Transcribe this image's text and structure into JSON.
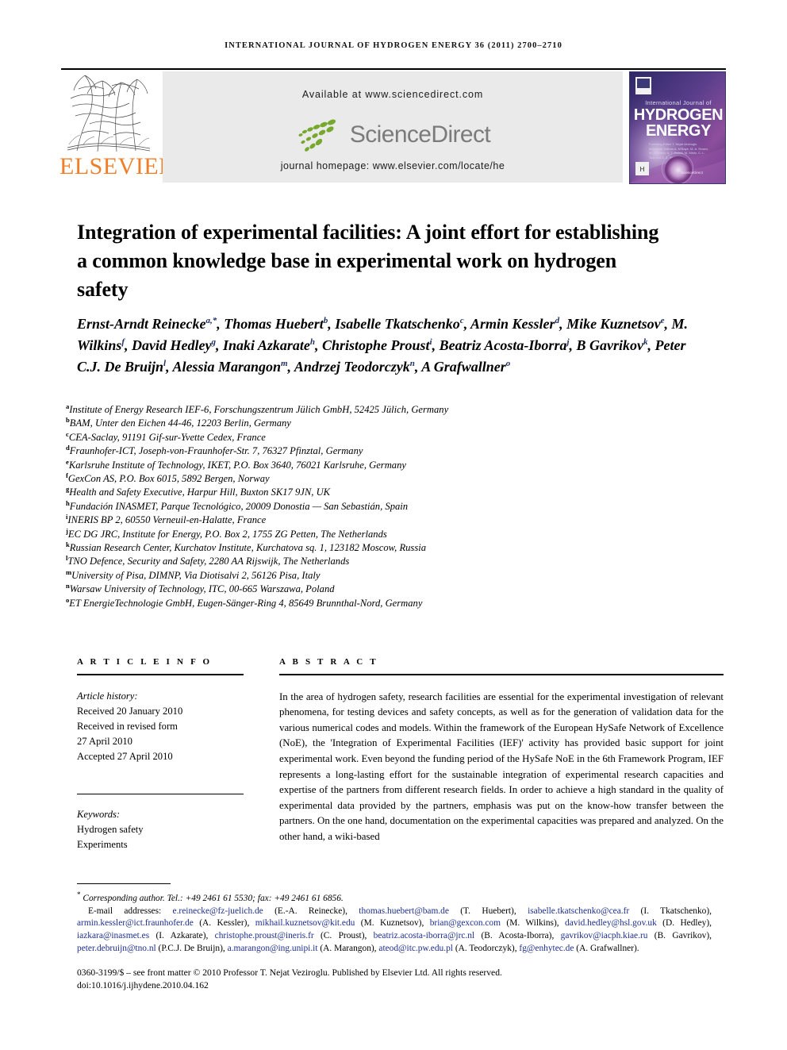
{
  "running_head": "INTERNATIONAL JOURNAL OF HYDROGEN ENERGY 36 (2011) 2700–2710",
  "masthead": {
    "publisher": "ELSEVIER",
    "available_at": "Available at www.sciencedirect.com",
    "sciencedirect_word": "ScienceDirect",
    "journal_homepage": "journal homepage: www.elsevier.com/locate/he",
    "cover": {
      "line_top": "International Journal of",
      "line_1": "HYDROGEN",
      "line_2": "ENERGY",
      "editor_block": "Founding Editor    T. Nejat Veziroglu\nAssociate Editors  A. M'Baye, M. A. Rosen, M. D. Mann,\nA. T. Raissi, M. Mintz,\nC. L. Toal and S. A. Sherif",
      "sciencedirect_footer": "Available online at www.sciencedirect.com",
      "sciencedirect_label": "ScienceDirect"
    }
  },
  "title": "Integration of experimental facilities: A joint effort for establishing a common knowledge base in experimental work on hydrogen safety",
  "authors": [
    {
      "name": "Ernst-Arndt Reinecke",
      "sup": "a,*"
    },
    {
      "name": "Thomas Huebert",
      "sup": "b"
    },
    {
      "name": "Isabelle Tkatschenko",
      "sup": "c"
    },
    {
      "name": "Armin Kessler",
      "sup": "d"
    },
    {
      "name": "Mike Kuznetsov",
      "sup": "e"
    },
    {
      "name": "M. Wilkins",
      "sup": "f"
    },
    {
      "name": "David Hedley",
      "sup": "g"
    },
    {
      "name": "Inaki Azkarate",
      "sup": "h"
    },
    {
      "name": "Christophe Proust",
      "sup": "i"
    },
    {
      "name": "Beatriz Acosta-Iborra",
      "sup": "j"
    },
    {
      "name": "B Gavrikov",
      "sup": "k"
    },
    {
      "name": "Peter C.J. De Bruijn",
      "sup": "l"
    },
    {
      "name": "Alessia Marangon",
      "sup": "m"
    },
    {
      "name": "Andrzej Teodorczyk",
      "sup": "n"
    },
    {
      "name": "A Grafwallner",
      "sup": "o"
    }
  ],
  "affiliations": [
    {
      "sup": "a",
      "text": "Institute of Energy Research IEF-6, Forschungszentrum Jülich GmbH, 52425 Jülich, Germany"
    },
    {
      "sup": "b",
      "text": "BAM, Unter den Eichen 44-46, 12203 Berlin, Germany"
    },
    {
      "sup": "c",
      "text": "CEA-Saclay, 91191 Gif-sur-Yvette Cedex, France"
    },
    {
      "sup": "d",
      "text": "Fraunhofer-ICT, Joseph-von-Fraunhofer-Str. 7, 76327 Pfinztal, Germany"
    },
    {
      "sup": "e",
      "text": "Karlsruhe Institute of Technology, IKET, P.O. Box 3640, 76021 Karlsruhe, Germany"
    },
    {
      "sup": "f",
      "text": "GexCon AS, P.O. Box 6015, 5892 Bergen, Norway"
    },
    {
      "sup": "g",
      "text": "Health and Safety Executive, Harpur Hill, Buxton SK17 9JN, UK"
    },
    {
      "sup": "h",
      "text": "Fundación INASMET, Parque Tecnológico, 20009 Donostia — San Sebastián, Spain"
    },
    {
      "sup": "i",
      "text": "INERIS BP 2, 60550 Verneuil-en-Halatte, France"
    },
    {
      "sup": "j",
      "text": "EC DG JRC, Institute for Energy, P.O. Box 2, 1755 ZG Petten, The Netherlands"
    },
    {
      "sup": "k",
      "text": "Russian Research Center, Kurchatov Institute, Kurchatova sq. 1, 123182 Moscow, Russia"
    },
    {
      "sup": "l",
      "text": "TNO Defence, Security and Safety, 2280 AA Rijswijk, The Netherlands"
    },
    {
      "sup": "m",
      "text": "University of Pisa, DIMNP, Via Diotisalvi 2, 56126 Pisa, Italy"
    },
    {
      "sup": "n",
      "text": "Warsaw University of Technology, ITC, 00-665 Warszawa, Poland"
    },
    {
      "sup": "o",
      "text": "ET EnergieTechnologie GmbH, Eugen-Sänger-Ring 4, 85649 Brunnthal-Nord, Germany"
    }
  ],
  "article_info": {
    "heading": "A R T I C L E   I N F O",
    "history_label": "Article history:",
    "history": [
      "Received 20 January 2010",
      "Received in revised form",
      "27 April 2010",
      "Accepted 27 April 2010"
    ],
    "keywords_label": "Keywords:",
    "keywords": [
      "Hydrogen safety",
      "Experiments"
    ]
  },
  "abstract": {
    "heading": "A B S T R A C T",
    "text": "In the area of hydrogen safety, research facilities are essential for the experimental investigation of relevant phenomena, for testing devices and safety concepts, as well as for the generation of validation data for the various numerical codes and models. Within the framework of the European HySafe Network of Excellence (NoE), the 'Integration of Experimental Facilities (IEF)' activity has provided basic support for joint experimental work. Even beyond the funding period of the HySafe NoE in the 6th Framework Program, IEF represents a long-lasting effort for the sustainable integration of experimental research capacities and expertise of the partners from different research fields. In order to achieve a high standard in the quality of experimental data provided by the partners, emphasis was put on the know-how transfer between the partners. On the one hand, documentation on the experimental capacities was prepared and analyzed. On the other hand, a wiki-based"
  },
  "footnotes": {
    "corresponding": "Corresponding author. Tel.: +49 2461 61 5530; fax: +49 2461 61 6856.",
    "email_label": "E-mail addresses:",
    "emails": [
      {
        "addr": "e.reinecke@fz-juelich.de",
        "who": "(E.-A. Reinecke)"
      },
      {
        "addr": "thomas.huebert@bam.de",
        "who": "(T. Huebert)"
      },
      {
        "addr": "isabelle.tkatschenko@cea.fr",
        "who": "(I. Tkatschenko)"
      },
      {
        "addr": "armin.kessler@ict.fraunhofer.de",
        "who": "(A. Kessler)"
      },
      {
        "addr": "mikhail.kuznetsov@kit.edu",
        "who": "(M. Kuznetsov)"
      },
      {
        "addr": "brian@gexcon.com",
        "who": "(M. Wilkins)"
      },
      {
        "addr": "david.hedley@hsl.gov.uk",
        "who": "(D. Hedley)"
      },
      {
        "addr": "iazkara@inasmet.es",
        "who": "(I. Azkarate)"
      },
      {
        "addr": "christophe.proust@ineris.fr",
        "who": "(C. Proust)"
      },
      {
        "addr": "beatriz.acosta-iborra@jrc.nl",
        "who": "(B. Acosta-Iborra)"
      },
      {
        "addr": "gavrikov@iacph.kiae.ru",
        "who": "(B. Gavrikov)"
      },
      {
        "addr": "peter.debruijn@tno.nl",
        "who": "(P.C.J. De Bruijn)"
      },
      {
        "addr": "a.marangon@ing.unipi.it",
        "who": "(A. Marangon)"
      },
      {
        "addr": "ateod@itc.pw.edu.pl",
        "who": "(A. Teodorczyk)"
      },
      {
        "addr": "fg@enhytec.de",
        "who": "(A. Grafwallner)"
      }
    ],
    "copyright": "0360-3199/$ – see front matter © 2010 Professor T. Nejat Veziroglu. Published by Elsevier Ltd. All rights reserved.",
    "doi": "doi:10.1016/j.ijhydene.2010.04.162"
  },
  "colors": {
    "elsevier_orange": "#f07e26",
    "link_blue": "#1d2f8c",
    "sup_blue": "#1d2f63",
    "band_gray": "#eaeaea",
    "sciencedirect_gray": "#7b7b7b",
    "sciencedirect_green": "#76a82e"
  }
}
